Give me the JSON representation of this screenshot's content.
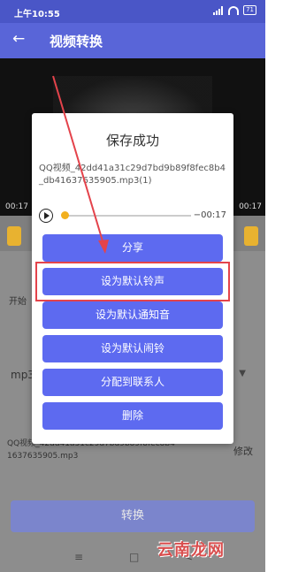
{
  "status_bar": {
    "time": "上午10:55",
    "battery": "71"
  },
  "app_bar": {
    "back_icon": "back-arrow-icon",
    "title": "视频转换"
  },
  "video": {
    "time_left": "00:17",
    "time_right": "00:17"
  },
  "background": {
    "start_label": "开始",
    "format_value": "mp3",
    "filename_line1": "QQ视频_42dd41a31c29d7bd9b89f8fec8b4",
    "filename_line2": "1637635905.mp3",
    "edit_label": "修改",
    "convert_button": "转换",
    "nav": {
      "menu": "≡",
      "home": "□",
      "back": "<"
    }
  },
  "dialog": {
    "title": "保存成功",
    "file_path": "QQ视频_42dd41a31c29d7bd9b89f8fec8b4_db41637635905.mp3(1)",
    "duration": "−00:17",
    "progress": 0,
    "buttons": [
      "分享",
      "设为默认铃声",
      "设为默认通知音",
      "设为默认闹铃",
      "分配到联系人",
      "删除"
    ]
  },
  "annotation": {
    "color": "#e4434b"
  },
  "watermark": "云南龙网"
}
